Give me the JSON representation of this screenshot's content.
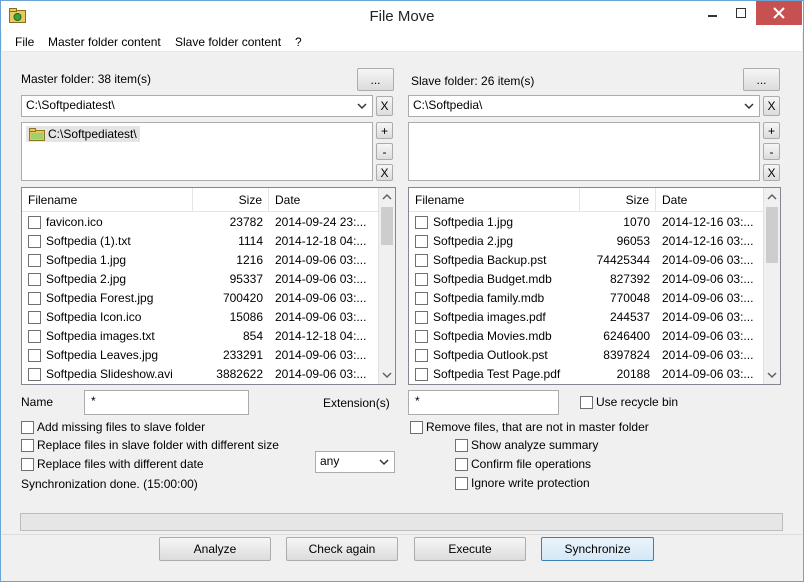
{
  "window": {
    "title": "File Move",
    "icon": "folder-sync-icon"
  },
  "menu": [
    "File",
    "Master folder content",
    "Slave folder content",
    "?"
  ],
  "master": {
    "label": "Master folder: 38 item(s)",
    "browse_label": "...",
    "path": "C:\\Softpediatest\\",
    "clear_label": "X",
    "list_items": [
      "C:\\Softpediatest\\"
    ],
    "add_label": "+",
    "remove_label": "-",
    "clear_list_label": "X",
    "columns": [
      "Filename",
      "Size",
      "Date"
    ],
    "rows": [
      {
        "name": "favicon.ico",
        "size": "23782",
        "date": "2014-09-24 23:..."
      },
      {
        "name": "Softpedia (1).txt",
        "size": "1114",
        "date": "2014-12-18 04:..."
      },
      {
        "name": "Softpedia 1.jpg",
        "size": "1216",
        "date": "2014-09-06 03:..."
      },
      {
        "name": "Softpedia 2.jpg",
        "size": "95337",
        "date": "2014-09-06 03:..."
      },
      {
        "name": "Softpedia Forest.jpg",
        "size": "700420",
        "date": "2014-09-06 03:..."
      },
      {
        "name": "Softpedia Icon.ico",
        "size": "15086",
        "date": "2014-09-06 03:..."
      },
      {
        "name": "Softpedia images.txt",
        "size": "854",
        "date": "2014-12-18 04:..."
      },
      {
        "name": "Softpedia Leaves.jpg",
        "size": "233291",
        "date": "2014-09-06 03:..."
      },
      {
        "name": "Softpedia Slideshow.avi",
        "size": "3882622",
        "date": "2014-09-06 03:..."
      }
    ]
  },
  "slave": {
    "label": "Slave folder: 26 item(s)",
    "browse_label": "...",
    "path": "C:\\Softpedia\\",
    "clear_label": "X",
    "add_label": "+",
    "remove_label": "-",
    "clear_list_label": "X",
    "columns": [
      "Filename",
      "Size",
      "Date"
    ],
    "rows": [
      {
        "name": "Softpedia 1.jpg",
        "size": "1070",
        "date": "2014-12-16 03:..."
      },
      {
        "name": "Softpedia 2.jpg",
        "size": "96053",
        "date": "2014-12-16 03:..."
      },
      {
        "name": "Softpedia Backup.pst",
        "size": "74425344",
        "date": "2014-09-06 03:..."
      },
      {
        "name": "Softpedia Budget.mdb",
        "size": "827392",
        "date": "2014-09-06 03:..."
      },
      {
        "name": "Softpedia family.mdb",
        "size": "770048",
        "date": "2014-09-06 03:..."
      },
      {
        "name": "Softpedia images.pdf",
        "size": "244537",
        "date": "2014-09-06 03:..."
      },
      {
        "name": "Softpedia Movies.mdb",
        "size": "6246400",
        "date": "2014-09-06 03:..."
      },
      {
        "name": "Softpedia Outlook.pst",
        "size": "8397824",
        "date": "2014-09-06 03:..."
      },
      {
        "name": "Softpedia Test Page.pdf",
        "size": "20188",
        "date": "2014-09-06 03:..."
      }
    ]
  },
  "filters": {
    "name_label": "Name",
    "name_value": "*",
    "extension_label": "Extension(s)",
    "extension_value": "*",
    "recycle_label": "Use recycle bin"
  },
  "options_left": {
    "add_missing": "Add missing files to slave folder",
    "replace_size": "Replace files in slave folder with different size",
    "replace_date": "Replace files with different date",
    "date_mode": "any",
    "status": "Synchronization done. (15:00:00)"
  },
  "options_right": {
    "remove_files": "Remove files, that are not in master folder",
    "show_summary": "Show analyze summary",
    "confirm_ops": "Confirm file operations",
    "ignore_protection": "Ignore write protection"
  },
  "buttons": {
    "analyze": "Analyze",
    "check_again": "Check again",
    "execute": "Execute",
    "synchronize": "Synchronize"
  }
}
